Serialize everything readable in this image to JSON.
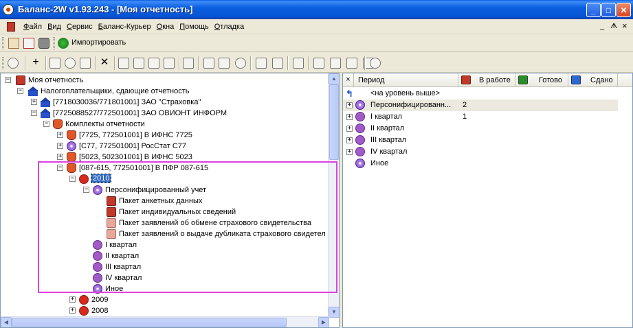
{
  "window": {
    "title": "Баланс-2W  v1.93.243 - [Моя отчетность]",
    "min_label": "_",
    "max_label": "□",
    "close_label": "✕"
  },
  "menu": {
    "items": [
      "Файл",
      "Вид",
      "Сервис",
      "Баланс-Курьер",
      "Окна",
      "Помощь",
      "Отладка"
    ],
    "mdi_minimize": "_",
    "mdi_restore": "ᗑ",
    "mdi_close": "×"
  },
  "toolbar1": {
    "import_label": "Импортировать"
  },
  "tree": {
    "root": "Моя отчетность",
    "taxpayers": "Налогоплательщики, сдающие отчетность",
    "org1": "[7718030036/771801001] ЗАО \"Страховка\"",
    "org2": "[7725088527/772501001] ЗАО ОВИОНТ ИНФОРМ",
    "kits": "Комплекты отчетности",
    "kit1": "[7725, 772501001] В ИФНС 7725",
    "kit2": "[С77, 772501001] РосСтат С77",
    "kit3": "[5023, 502301001] В ИФНС 5023",
    "kit4": "[087-615, 772501001] В ПФР 087-615",
    "year2010": "2010",
    "personified": "Персонифицированный учет",
    "pkg1": "Пакет анкетных данных",
    "pkg2": "Пакет индивидуальных сведений",
    "pkg3": "Пакет заявлений об обмене страхового свидетельства",
    "pkg4": "Пакет заявлений о выдаче дубликата страхового свидетел",
    "q1": "I квартал",
    "q2": "II квартал",
    "q3": "III квартал",
    "q4": "IV квартал",
    "other": "Иное",
    "year2009": "2009",
    "year2008": "2008"
  },
  "grid": {
    "headers": {
      "x": "×",
      "period": "Период",
      "in_work": "В работе",
      "ready": "Готово",
      "sent": "Сдано"
    },
    "up_level": "<на уровень выше>",
    "rows": [
      {
        "label": "Персонифицированн...",
        "in_work": "2"
      },
      {
        "label": "I квартал",
        "in_work": "1"
      },
      {
        "label": "II квартал",
        "in_work": ""
      },
      {
        "label": "III квартал",
        "in_work": ""
      },
      {
        "label": "IV квартал",
        "in_work": ""
      },
      {
        "label": "Иное",
        "in_work": ""
      }
    ]
  },
  "colors": {
    "titlebar": "#0653d2",
    "selection": "#316ac5",
    "highlight_frame": "#e040e0"
  }
}
